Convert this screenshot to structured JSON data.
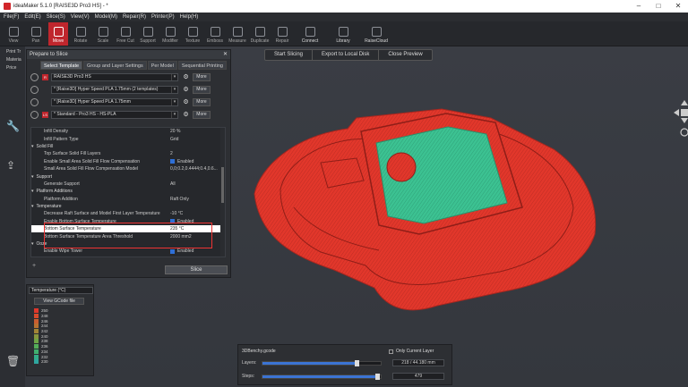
{
  "window": {
    "title": "ideaMaker 5.1.0 [RAISE3D Pro3 HS] - *",
    "controls": [
      "–",
      "□",
      "✕"
    ]
  },
  "menu": [
    "File(F)",
    "Edit(E)",
    "Slice(S)",
    "View(V)",
    "Model(M)",
    "Repair(R)",
    "Printer(P)",
    "Help(H)"
  ],
  "toolbar": {
    "tools": [
      "View",
      "Pan",
      "Move",
      "Rotate",
      "Scale",
      "Free Cut",
      "Support",
      "Modifier",
      "Texture",
      "Emboss",
      "Measure",
      "Duplicate",
      "Repair"
    ],
    "active_index": 2,
    "right_tools": [
      "Connect",
      "Library",
      "RaiseCloud"
    ]
  },
  "leftbar": {
    "labels": [
      "Print Tr",
      "Materia",
      "Price"
    ]
  },
  "action_bar": {
    "start_slicing": "Start Slicing",
    "export": "Export to Local Disk",
    "close_preview": "Close Preview"
  },
  "dialog": {
    "title": "Prepare to Slice",
    "tabs": [
      "Select Template",
      "Group and Layer Settings",
      "Per Model",
      "Sequential Printing"
    ],
    "active_tab": 0,
    "presets": [
      {
        "badge": "R",
        "text": "RAISE3D Pro3 HS",
        "more": "More"
      },
      {
        "badge": "",
        "text": "* [Raise3D] Hyper Speed PLA 1.75mm (2 templates)",
        "more": "More"
      },
      {
        "badge": "",
        "text": "* [Raise3D] Hyper Speed PLA 1.75mm",
        "more": "More"
      },
      {
        "badge": "LS",
        "text": "* Standard - Pro3 HS - HS-PLA",
        "more": "More"
      }
    ],
    "settings": [
      {
        "type": "item",
        "label": "Infill Density",
        "value": "20 %"
      },
      {
        "type": "item",
        "label": "Infill Pattern Type",
        "value": "Grid"
      },
      {
        "type": "cat",
        "label": "Solid Fill",
        "value": ""
      },
      {
        "type": "item",
        "label": "Top Surface Solid Fill Layers",
        "value": "2"
      },
      {
        "type": "item",
        "label": "Enable Small Area Solid Fill Flow Compensation",
        "value": "Enabled",
        "check": true
      },
      {
        "type": "item",
        "label": "Small Area Solid Fill Flow Compensation Model",
        "value": "0,0;0.2,0.4444;0.4,0.6..."
      },
      {
        "type": "cat",
        "label": "Support",
        "value": ""
      },
      {
        "type": "item",
        "label": "Generate Support",
        "value": "All"
      },
      {
        "type": "cat",
        "label": "Platform Additions",
        "value": ""
      },
      {
        "type": "item",
        "label": "Platform Addition",
        "value": "Raft Only"
      },
      {
        "type": "cat",
        "label": "Temperature",
        "value": ""
      },
      {
        "type": "item",
        "label": "Decrease Raft Surface and Model First Layer Temperature",
        "value": "-10 °C"
      },
      {
        "type": "item",
        "label": "Enable Bottom Surface Temperature",
        "value": "Enabled",
        "check": true
      },
      {
        "type": "item",
        "label": "Bottom Surface Temperature",
        "value": "235 °C",
        "selected": true
      },
      {
        "type": "item",
        "label": "Bottom Surface Temperature Area Threshold",
        "value": "2000 mm2"
      },
      {
        "type": "cat",
        "label": "Ooze",
        "value": ""
      },
      {
        "type": "item",
        "label": "Enable Wipe Tower",
        "value": "Enabled",
        "check": true
      }
    ],
    "footer": {
      "add": "+",
      "slice": "Slice"
    }
  },
  "legend": {
    "mode": "Temperature (°C)",
    "button": "View GCode file",
    "entries": [
      {
        "value": "250",
        "color": "#e2372b"
      },
      {
        "value": "248",
        "color": "#d8492c"
      },
      {
        "value": "246",
        "color": "#cc5d2f"
      },
      {
        "value": "244",
        "color": "#b97131"
      },
      {
        "value": "242",
        "color": "#a28536"
      },
      {
        "value": "240",
        "color": "#88963d"
      },
      {
        "value": "238",
        "color": "#6ea446"
      },
      {
        "value": "236",
        "color": "#54ad58"
      },
      {
        "value": "234",
        "color": "#3fb06f"
      },
      {
        "value": "232",
        "color": "#33ad88"
      },
      {
        "value": "230",
        "color": "#2fa79f"
      }
    ]
  },
  "bottom_panel": {
    "file": "3DBenchy.gcode",
    "only_current_layer": "Only Current Layer",
    "layers_label": "Layers:",
    "layers_value": "218 / 44.180 mm",
    "layers_fraction": 0.8,
    "steps_label": "Steps:",
    "steps_value": "479",
    "steps_fraction": 0.98
  },
  "colors": {
    "accent": "#c0262d",
    "model": "#e2372b",
    "top_layer": "#3cc292"
  }
}
